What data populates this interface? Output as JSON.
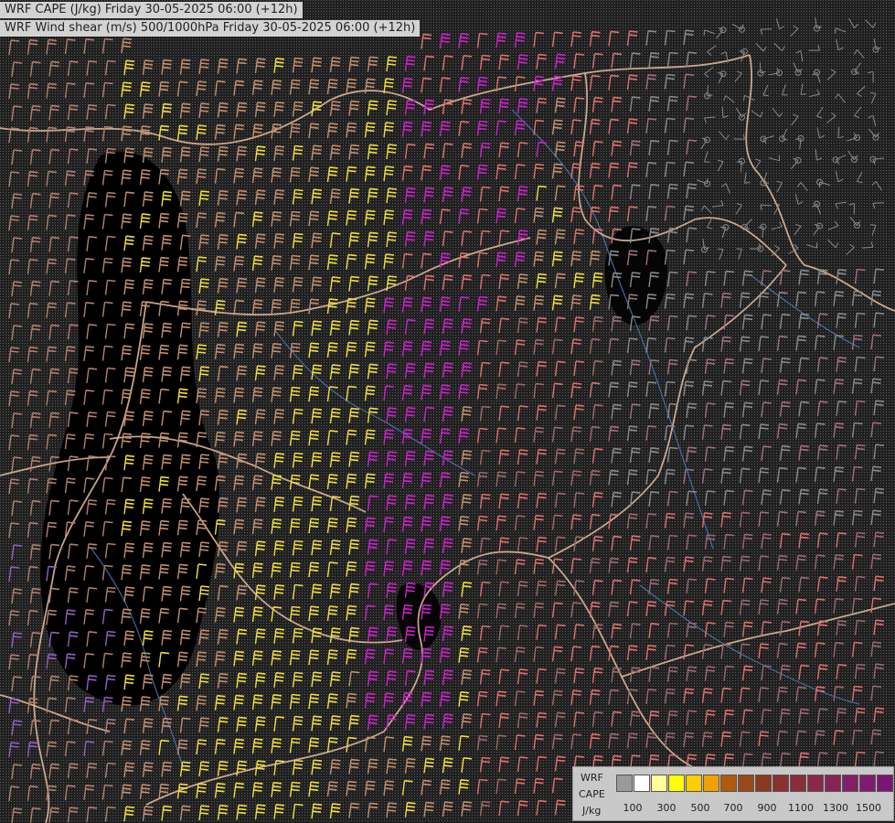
{
  "titles": {
    "line1": "WRF CAPE (J/kg) Friday 30-05-2025 06:00 (+12h)",
    "line2": "WRF Wind shear (m/s) 500/1000hPa Friday 30-05-2025 06:00 (+12h)"
  },
  "legend": {
    "label_wrf": "WRF",
    "label_cape": "CAPE",
    "label_units": "J/kg",
    "colors": [
      "#9a9a9a",
      "#ffffff",
      "#ffff99",
      "#ffff00",
      "#ffcc00",
      "#f0a000",
      "#b05a10",
      "#9a4a1a",
      "#8a3a1c",
      "#8a3030",
      "#8a2c3c",
      "#8a2848",
      "#862458",
      "#822064",
      "#7e1c70",
      "#7a1478"
    ],
    "tick_labels": [
      "100",
      "300",
      "500",
      "700",
      "900",
      "1100",
      "1300",
      "1500"
    ]
  },
  "colors": {
    "background": "#000000",
    "barb_grey": "#8a8a8a",
    "barb_tan": "#c29070",
    "barb_yellow": "#f0e040",
    "barb_magenta": "#d020d0",
    "barb_salmon": "#e07070",
    "border": "#e8c0a0",
    "river": "#5080c0"
  }
}
